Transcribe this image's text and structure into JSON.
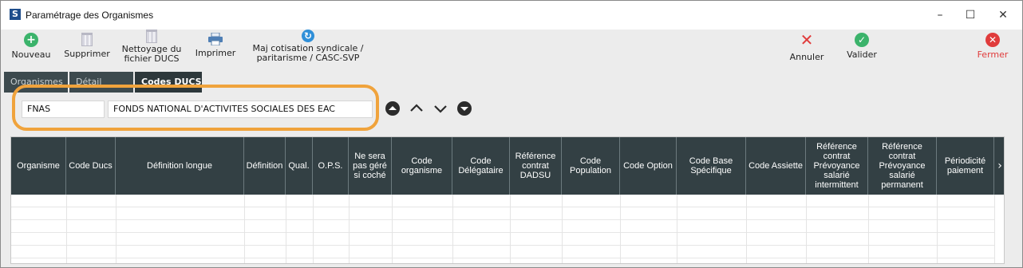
{
  "window": {
    "app_icon_letter": "S",
    "title": "Paramétrage des Organismes",
    "minimize_glyph": "–",
    "maximize_glyph": "☐",
    "close_glyph": "✕"
  },
  "toolbar": {
    "nouveau": {
      "label": "Nouveau",
      "icon": "plus-circle-icon"
    },
    "supprimer": {
      "label": "Supprimer",
      "icon": "trash-icon"
    },
    "nettoyage": {
      "label_line1": "Nettoyage du",
      "label_line2": "fichier DUCS",
      "icon": "trash-icon"
    },
    "imprimer": {
      "label": "Imprimer",
      "icon": "printer-icon"
    },
    "maj": {
      "label_line1": "Maj cotisation syndicale /",
      "label_line2": "paritarisme / CASC-SVP",
      "icon": "refresh-icon"
    },
    "annuler": {
      "label": "Annuler",
      "icon": "red-x-icon"
    },
    "valider": {
      "label": "Valider",
      "icon": "check-circle-icon"
    },
    "fermer": {
      "label": "Fermer",
      "icon": "close-circle-icon"
    }
  },
  "tabs": [
    {
      "label": "Organismes"
    },
    {
      "label": "Détail"
    },
    {
      "label": "Codes DUCS"
    }
  ],
  "active_tab": "Codes DUCS",
  "search": {
    "code": "FNAS",
    "description": "FONDS NATIONAL D'ACTIVITES SOCIALES DES EAC"
  },
  "grid": {
    "columns": [
      {
        "label": "Organisme"
      },
      {
        "label": "Code Ducs"
      },
      {
        "label": "Définition longue"
      },
      {
        "label": "Définition"
      },
      {
        "label": "Qual."
      },
      {
        "label": "O.P.S."
      },
      {
        "label": "Ne sera pas géré si coché"
      },
      {
        "label": "Code organisme"
      },
      {
        "label": "Code Délégataire"
      },
      {
        "label": "Référence contrat DADSU"
      },
      {
        "label": "Code Population"
      },
      {
        "label": "Code Option"
      },
      {
        "label": "Code Base Spécifique"
      },
      {
        "label": "Code Assiette"
      },
      {
        "label": "Référence contrat Prévoyance salarié intermittent"
      },
      {
        "label": "Référence contrat Prévoyance salarié permanent"
      },
      {
        "label": "Périodicité paiement"
      }
    ],
    "rows": []
  },
  "colors": {
    "header_bg": "#334044",
    "highlight": "#f0a33c",
    "tab_active_bg": "#2d383b"
  }
}
